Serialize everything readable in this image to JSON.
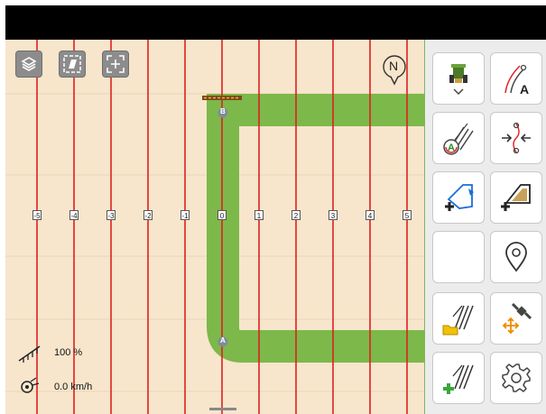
{
  "map": {
    "track_numbers": [
      "-5",
      "-4",
      "-3",
      "-2",
      "-1",
      "0",
      "1",
      "2",
      "3",
      "4",
      "5"
    ],
    "point_a_label": "A",
    "point_b_label": "B",
    "compass_label": "N",
    "colors": {
      "field": "#f7e6cc",
      "track_line": "#e02020",
      "path": "#7db84a",
      "grid": "#e8d2b0"
    }
  },
  "status": {
    "application_rate": "100 %",
    "speed": "0.0 km/h"
  },
  "toolbar": {
    "left_icons": [
      "layers-icon",
      "field-view-icon",
      "center-position-icon"
    ],
    "right_buttons": [
      "machine-profile-icon",
      "guidance-line-a-icon",
      "auto-guidance-icon",
      "track-shift-icon",
      "add-boundary-icon",
      "add-field-area-icon",
      "empty-slot",
      "location-pin-icon",
      "load-tracks-icon",
      "satellite-move-icon",
      "add-tracks-icon",
      "settings-gear-icon"
    ]
  }
}
